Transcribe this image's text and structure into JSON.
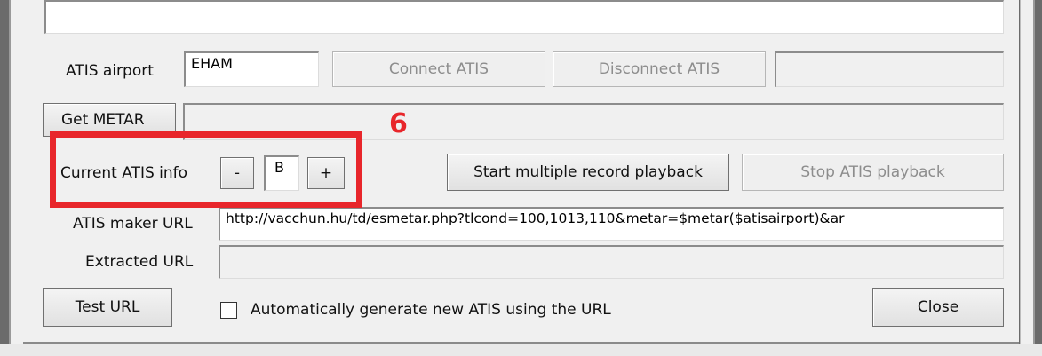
{
  "form": {
    "atis_airport_label": "ATIS airport",
    "atis_airport_value": "EHAM",
    "connect_label": "Connect ATIS",
    "disconnect_label": "Disconnect ATIS",
    "get_metar_label": "Get METAR",
    "current_atis_label": "Current ATIS info",
    "decrement_label": "-",
    "atis_letter": "B",
    "increment_label": "+",
    "start_playback_label": "Start multiple record playback",
    "stop_playback_label": "Stop ATIS playback",
    "atis_maker_url_label": "ATIS maker URL",
    "atis_maker_url_value": "http://vacchun.hu/td/esmetar.php?tlcond=100,1013,110&metar=$metar($atisairport)&ar",
    "extracted_url_label": "Extracted URL",
    "test_url_label": "Test URL",
    "auto_generate_label": "Automatically generate new ATIS using the URL",
    "close_label": "Close"
  },
  "annotation": {
    "number": "6",
    "color": "#e8262b"
  }
}
